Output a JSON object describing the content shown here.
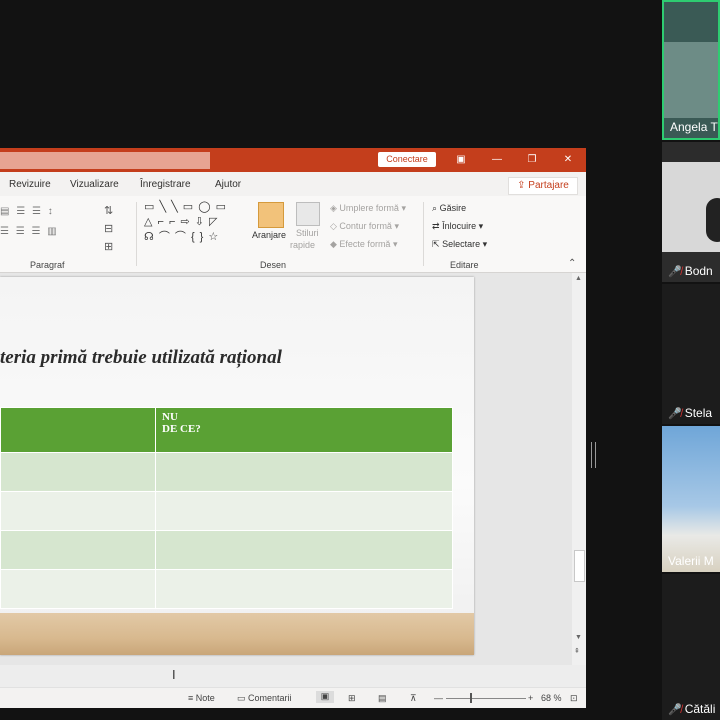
{
  "powerpoint": {
    "titlebar": {
      "connect_label": "Conectare",
      "btn_ribbon": "▣",
      "btn_min": "—",
      "btn_max": "❐",
      "btn_close": "✕"
    },
    "menu": [
      {
        "label": "Revizuire"
      },
      {
        "label": "Vizualizare"
      },
      {
        "label": "Înregistrare"
      },
      {
        "label": "Ajutor"
      }
    ],
    "share_label": "Partajare",
    "ribbon": {
      "groups": {
        "paragraph": "Paragraf",
        "drawing": "Desen",
        "editing": "Editare"
      },
      "arrange": "Aranjare",
      "styles_line1": "Stiluri",
      "styles_line2": "rapide",
      "fill": "Umplere formă",
      "outline": "Contur formă",
      "effects": "Efecte formă",
      "find": "Găsire",
      "replace": "Înlocuire",
      "select": "Selectare",
      "shapes_row1": "▭ ╲ ╲ ▭ ◯ ▭",
      "shapes_row2": "△ ⌐ ⌐ ⇨ ⇩ ◸",
      "shapes_row3": "☊ ⌒ ⌒ { } ☆"
    },
    "slide": {
      "title": "teria primă trebuie utilizată rațional",
      "table_header_line1": "NU",
      "table_header_line2": "DE CE?"
    },
    "status": {
      "notes": "Note",
      "comments": "Comentarii",
      "zoom": "68 %"
    }
  },
  "participants": [
    {
      "name": "Angela T",
      "muted": false,
      "bg": "#3a5a55"
    },
    {
      "name": "Bodn",
      "muted": true,
      "bg": "#2c2c2c"
    },
    {
      "name": "Stela",
      "muted": true,
      "bg": "#1c1c1c"
    },
    {
      "name": "Valerii M",
      "muted": false,
      "bg": "#6fa6d8"
    },
    {
      "name": "Cătăli",
      "muted": true,
      "bg": "#1c1c1c"
    }
  ],
  "colors": {
    "accent": "#c43e1c",
    "table_header": "#5aa134",
    "active_speaker_border": "#2ecc71"
  }
}
